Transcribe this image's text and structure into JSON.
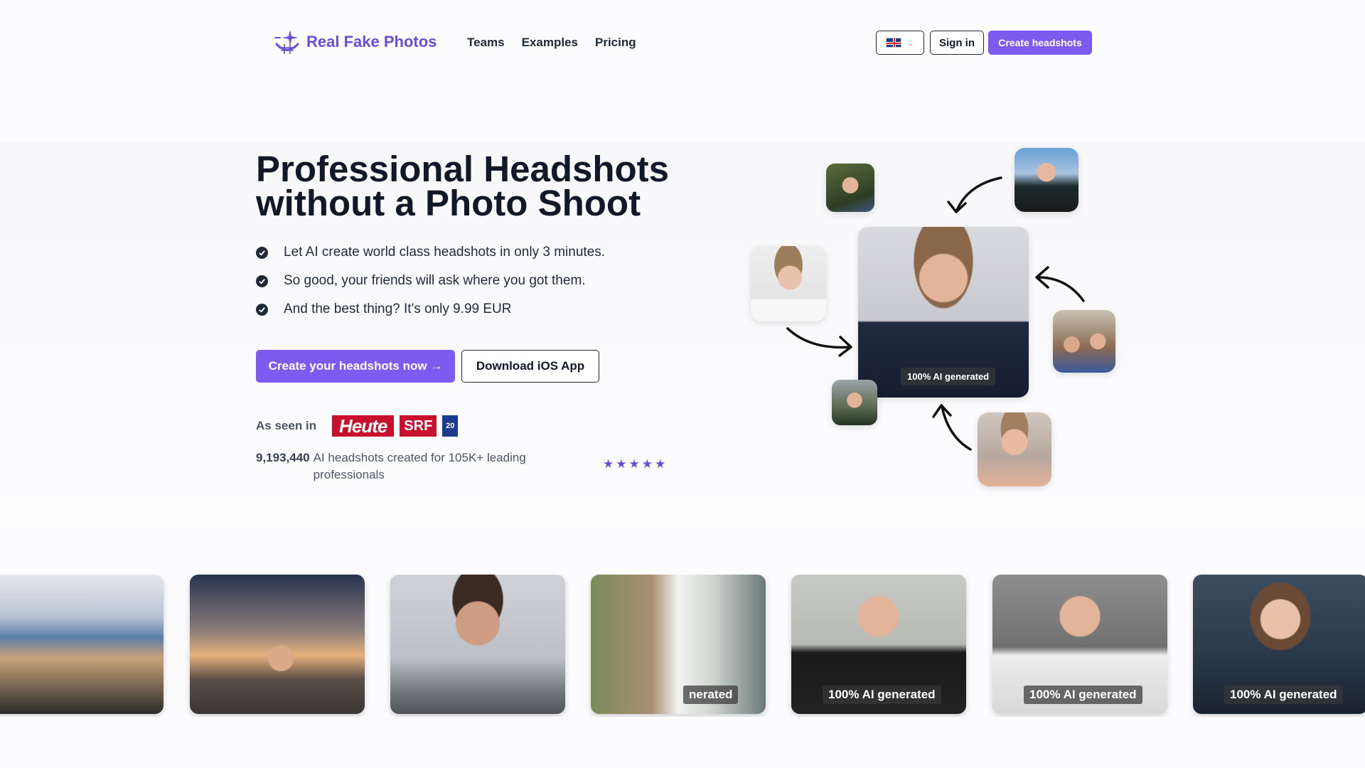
{
  "brand": {
    "name": "Real Fake Photos",
    "accent": "#7c5cf0",
    "logo_icon": "sparkle-smile-icon"
  },
  "nav": {
    "links": [
      "Teams",
      "Examples",
      "Pricing"
    ],
    "language": "uk-flag-icon",
    "signin_label": "Sign in",
    "create_label": "Create headshots"
  },
  "hero": {
    "title_line1": "Professional Headshots",
    "title_line2": "without a Photo Shoot",
    "bullets": [
      "Let AI create world class headshots in only 3 minutes.",
      "So good, your friends will ask where you got them.",
      "And the best thing? It's only 9.99 EUR"
    ],
    "cta_primary": "Create your headshots now →",
    "cta_secondary": "Download iOS App",
    "as_seen_label": "As seen in",
    "press": {
      "heute": "Heute",
      "srf": "SRF",
      "zdf": "20"
    },
    "stats_number": "9,193,440",
    "stats_text": "AI headshots created for 105K+ leading professionals",
    "rating_stars": 5
  },
  "collage": {
    "main_badge": "100% AI generated"
  },
  "gallery": {
    "badge": "100% AI generated",
    "badge_partial": "nerated"
  }
}
